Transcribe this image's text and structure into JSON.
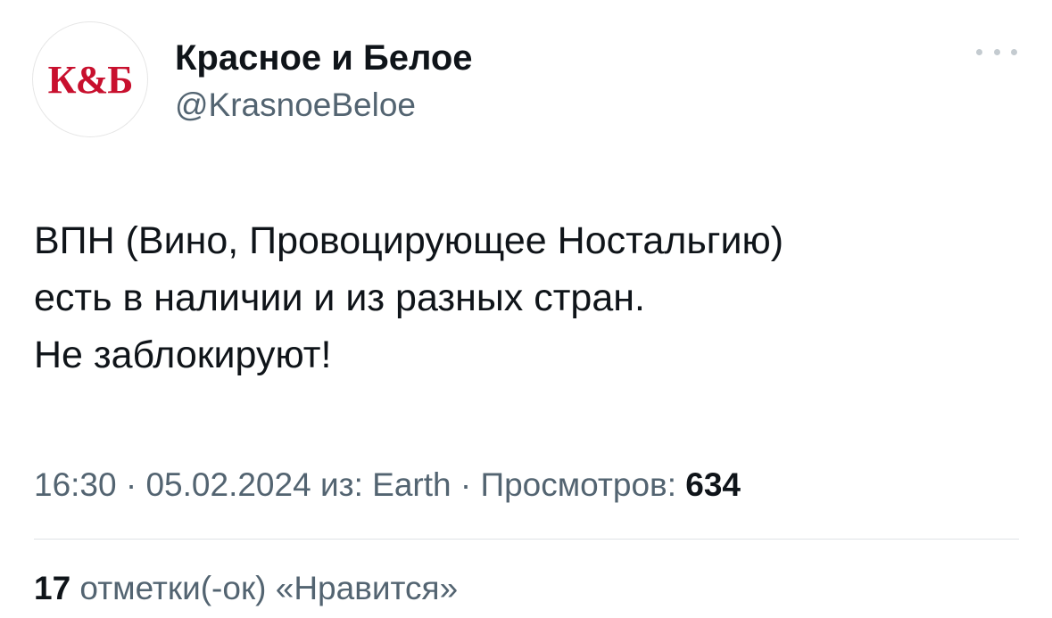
{
  "account": {
    "avatar_text": "К&Б",
    "display_name": "Красное и Белое",
    "handle": "@KrasnoeBeloe",
    "brand_color": "#c8102e"
  },
  "tweet": {
    "lines": [
      "ВПН (Вино, Провоцирующее Ностальгию)",
      "есть в наличии и из разных стран.",
      "Не заблокируют!"
    ]
  },
  "meta": {
    "time": "16:30",
    "sep1": " · ",
    "date": "05.02.2024",
    "source_prefix": " из: ",
    "source": "Earth",
    "sep2": " · ",
    "views_label": "Просмотров: ",
    "views_count": "634"
  },
  "likes": {
    "count": "17",
    "label": " отметки(-ок) «Нравится»"
  },
  "icons": {
    "more": "more-horizontal-icon"
  }
}
